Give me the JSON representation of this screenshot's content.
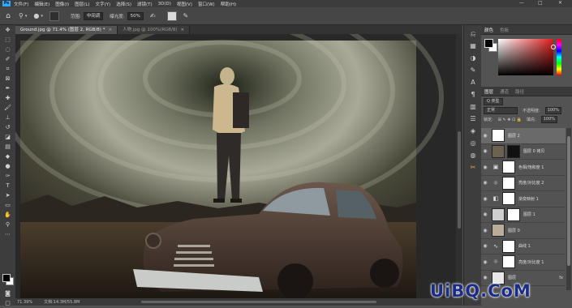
{
  "menubar": {
    "logo": "Ps",
    "items": [
      "文件(F)",
      "编辑(E)",
      "图像(I)",
      "图层(L)",
      "文字(Y)",
      "选择(S)",
      "滤镜(T)",
      "3D(D)",
      "视图(V)",
      "窗口(W)",
      "帮助(H)"
    ],
    "min": "—",
    "max": "□",
    "close": "✕"
  },
  "optionsbar": {
    "range_label": "范围:",
    "range_value": "中间调",
    "exposure_label": "曝光度:",
    "exposure_value": "50%"
  },
  "tabs": [
    {
      "label": "Ground.jpg @ 71.4% (图层 2, RGB/8) *",
      "active": true,
      "close": "×"
    },
    {
      "label": "人物.jpg @ 100%(RGB/8)",
      "active": false,
      "close": "×"
    }
  ],
  "statusbar": {
    "zoom": "71.39%",
    "doc": "文档:14.3M/55.8M"
  },
  "panels": {
    "color_tabs": [
      "颜色",
      "色板"
    ],
    "layer_tabs": [
      "图层",
      "通道",
      "路径"
    ],
    "kind_label": "Q 类型",
    "blend_mode": "正常",
    "opacity_label": "不透明度:",
    "opacity_value": "100%",
    "lock_label": "锁定:",
    "fill_label": "填充:",
    "fill_value": "100%"
  },
  "layers": [
    {
      "name": "图层 2",
      "type": "pixel",
      "selected": true
    },
    {
      "name": "图层 0 拷贝",
      "type": "pixel-mask",
      "selected": false
    },
    {
      "name": "色相/饱和度 1",
      "type": "adjustment",
      "icon": "▣",
      "selected": false
    },
    {
      "name": "亮度/对比度 2",
      "type": "adjustment",
      "icon": "☼",
      "selected": false
    },
    {
      "name": "渐变映射 1",
      "type": "adjustment",
      "icon": "◧",
      "selected": false
    },
    {
      "name": "图层 1",
      "type": "pixel-mask",
      "selected": false
    },
    {
      "name": "图层 0",
      "type": "pixel",
      "selected": false
    },
    {
      "name": "曲线 1",
      "type": "adjustment",
      "icon": "∿",
      "selected": false
    },
    {
      "name": "亮度/对比度 1",
      "type": "adjustment",
      "icon": "☼",
      "selected": false
    },
    {
      "name": "图层",
      "type": "pixel",
      "selected": false,
      "fx": "fx"
    }
  ],
  "watermark": "UiBQ.CoM",
  "colors": {
    "accent": "#31a8ff",
    "menubar": "#3c3c3c",
    "panel": "#535353"
  }
}
